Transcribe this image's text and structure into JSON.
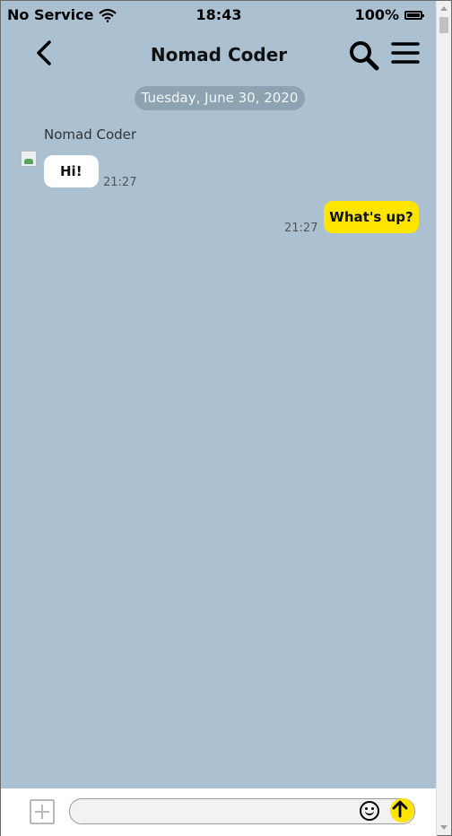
{
  "status_bar": {
    "carrier": "No Service",
    "time": "18:43",
    "battery": "100%"
  },
  "header": {
    "title": "Nomad Coder",
    "icons": {
      "back": "chevron-left-icon",
      "search": "search-icon",
      "menu": "menu-icon"
    }
  },
  "chat": {
    "date": "Tuesday, June 30, 2020",
    "messages": [
      {
        "direction": "incoming",
        "sender": "Nomad Coder",
        "text": "Hi!",
        "time": "21:27"
      },
      {
        "direction": "outgoing",
        "text": "What's up?",
        "time": "21:27"
      }
    ]
  },
  "composer": {
    "input_value": "",
    "icons": {
      "attach": "plus-icon",
      "emoji": "smile-icon",
      "send": "arrow-up-icon"
    }
  },
  "colors": {
    "background": "#abc1d1",
    "outgoing_bubble": "#fee500",
    "incoming_bubble": "#ffffff",
    "date_pill": "#8ea3b1"
  }
}
